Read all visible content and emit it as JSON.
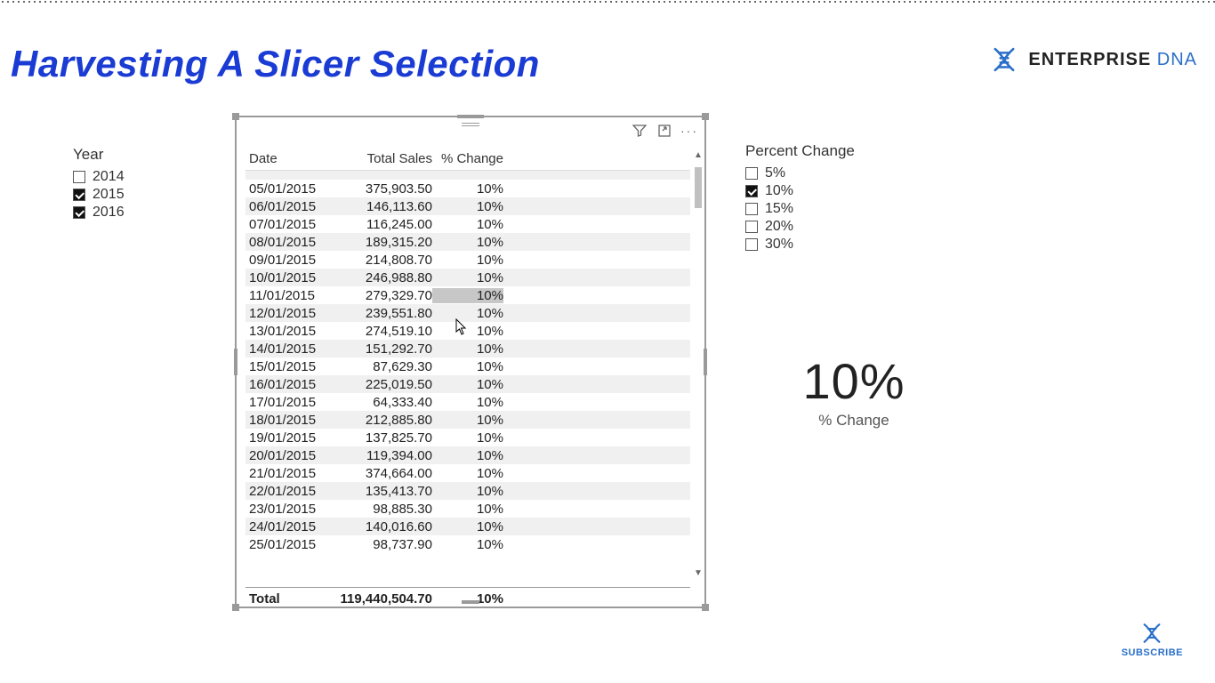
{
  "title": "Harvesting A Slicer Selection",
  "brand": {
    "ent": "ENTERPRISE",
    "dna": " DNA"
  },
  "year_slicer": {
    "title": "Year",
    "items": [
      {
        "label": "2014",
        "checked": false
      },
      {
        "label": "2015",
        "checked": true
      },
      {
        "label": "2016",
        "checked": true
      }
    ]
  },
  "pct_slicer": {
    "title": "Percent Change",
    "items": [
      {
        "label": "5%",
        "checked": false
      },
      {
        "label": "10%",
        "checked": true
      },
      {
        "label": "15%",
        "checked": false
      },
      {
        "label": "20%",
        "checked": false
      },
      {
        "label": "30%",
        "checked": false
      }
    ]
  },
  "table": {
    "headers": {
      "date": "Date",
      "sales": "Total Sales",
      "change": "% Change"
    },
    "rows": [
      {
        "date": "05/01/2015",
        "sales": "375,903.50",
        "change": "10%"
      },
      {
        "date": "06/01/2015",
        "sales": "146,113.60",
        "change": "10%"
      },
      {
        "date": "07/01/2015",
        "sales": "116,245.00",
        "change": "10%"
      },
      {
        "date": "08/01/2015",
        "sales": "189,315.20",
        "change": "10%"
      },
      {
        "date": "09/01/2015",
        "sales": "214,808.70",
        "change": "10%"
      },
      {
        "date": "10/01/2015",
        "sales": "246,988.80",
        "change": "10%"
      },
      {
        "date": "11/01/2015",
        "sales": "279,329.70",
        "change": "10%",
        "hoverChange": true
      },
      {
        "date": "12/01/2015",
        "sales": "239,551.80",
        "change": "10%"
      },
      {
        "date": "13/01/2015",
        "sales": "274,519.10",
        "change": "10%"
      },
      {
        "date": "14/01/2015",
        "sales": "151,292.70",
        "change": "10%"
      },
      {
        "date": "15/01/2015",
        "sales": "87,629.30",
        "change": "10%"
      },
      {
        "date": "16/01/2015",
        "sales": "225,019.50",
        "change": "10%"
      },
      {
        "date": "17/01/2015",
        "sales": "64,333.40",
        "change": "10%"
      },
      {
        "date": "18/01/2015",
        "sales": "212,885.80",
        "change": "10%"
      },
      {
        "date": "19/01/2015",
        "sales": "137,825.70",
        "change": "10%"
      },
      {
        "date": "20/01/2015",
        "sales": "119,394.00",
        "change": "10%"
      },
      {
        "date": "21/01/2015",
        "sales": "374,664.00",
        "change": "10%"
      },
      {
        "date": "22/01/2015",
        "sales": "135,413.70",
        "change": "10%"
      },
      {
        "date": "23/01/2015",
        "sales": "98,885.30",
        "change": "10%"
      },
      {
        "date": "24/01/2015",
        "sales": "140,016.60",
        "change": "10%"
      },
      {
        "date": "25/01/2015",
        "sales": "98,737.90",
        "change": "10%"
      }
    ],
    "total": {
      "label": "Total",
      "sales": "119,440,504.70",
      "change": "10%"
    }
  },
  "card": {
    "value": "10%",
    "label": "% Change"
  },
  "subscribe": "SUBSCRIBE"
}
